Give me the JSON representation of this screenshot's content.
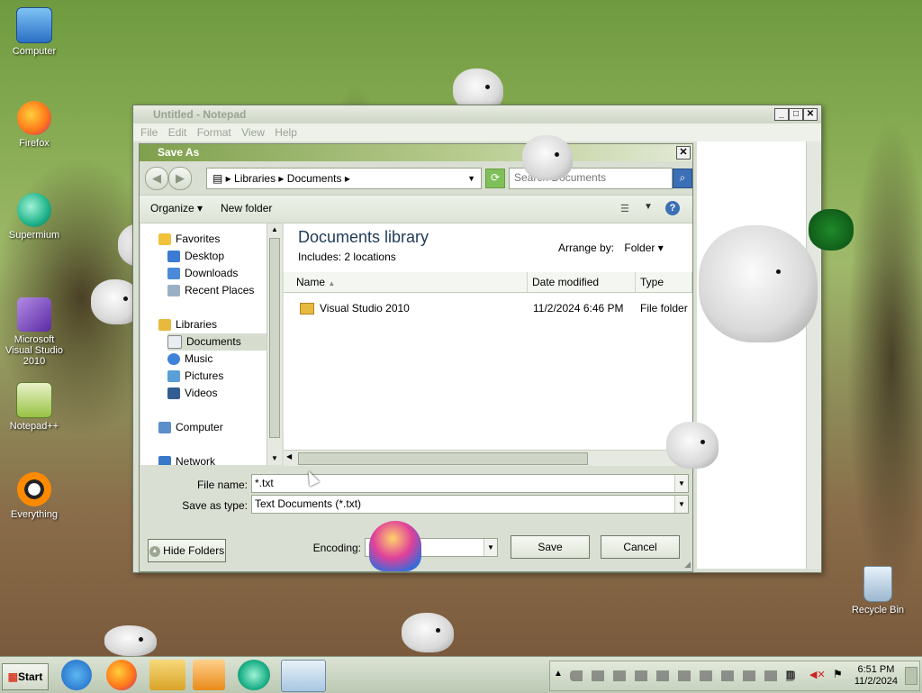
{
  "desktop": {
    "icons": [
      {
        "label": "Computer"
      },
      {
        "label": "Firefox"
      },
      {
        "label": "Supermium"
      },
      {
        "label": "Microsoft Visual Studio 2010"
      },
      {
        "label": "Notepad++"
      },
      {
        "label": "Everything"
      },
      {
        "label": "Recycle Bin"
      }
    ]
  },
  "notepad": {
    "title": "Untitled - Notepad",
    "menu": [
      "File",
      "Edit",
      "Format",
      "View",
      "Help"
    ]
  },
  "save_dialog": {
    "title": "Save As",
    "address": {
      "segments": [
        "Libraries",
        "Documents"
      ]
    },
    "search_placeholder": "Search Documents",
    "toolbar": {
      "organize": "Organize",
      "new_folder": "New folder"
    },
    "nav": {
      "favorites": "Favorites",
      "desktop": "Desktop",
      "downloads": "Downloads",
      "recent": "Recent Places",
      "libraries": "Libraries",
      "documents": "Documents",
      "music": "Music",
      "pictures": "Pictures",
      "videos": "Videos",
      "computer": "Computer",
      "network": "Network"
    },
    "library": {
      "title": "Documents library",
      "includes_label": "Includes:",
      "includes_link": "2 locations",
      "arrange_label": "Arrange by:",
      "arrange_value": "Folder"
    },
    "columns": [
      "Name",
      "Date modified",
      "Type"
    ],
    "rows": [
      {
        "name": "Visual Studio 2010",
        "date": "11/2/2024 6:46 PM",
        "type": "File folder"
      }
    ],
    "file_name_label": "File name:",
    "file_name_value": "*.txt",
    "save_type_label": "Save as type:",
    "save_type_value": "Text Documents (*.txt)",
    "hide_folders": "Hide Folders",
    "encoding_label": "Encoding:",
    "encoding_value": "",
    "save_button": "Save",
    "cancel_button": "Cancel"
  },
  "taskbar": {
    "start": "Start",
    "clock_time": "6:51 PM",
    "clock_date": "11/2/2024"
  }
}
